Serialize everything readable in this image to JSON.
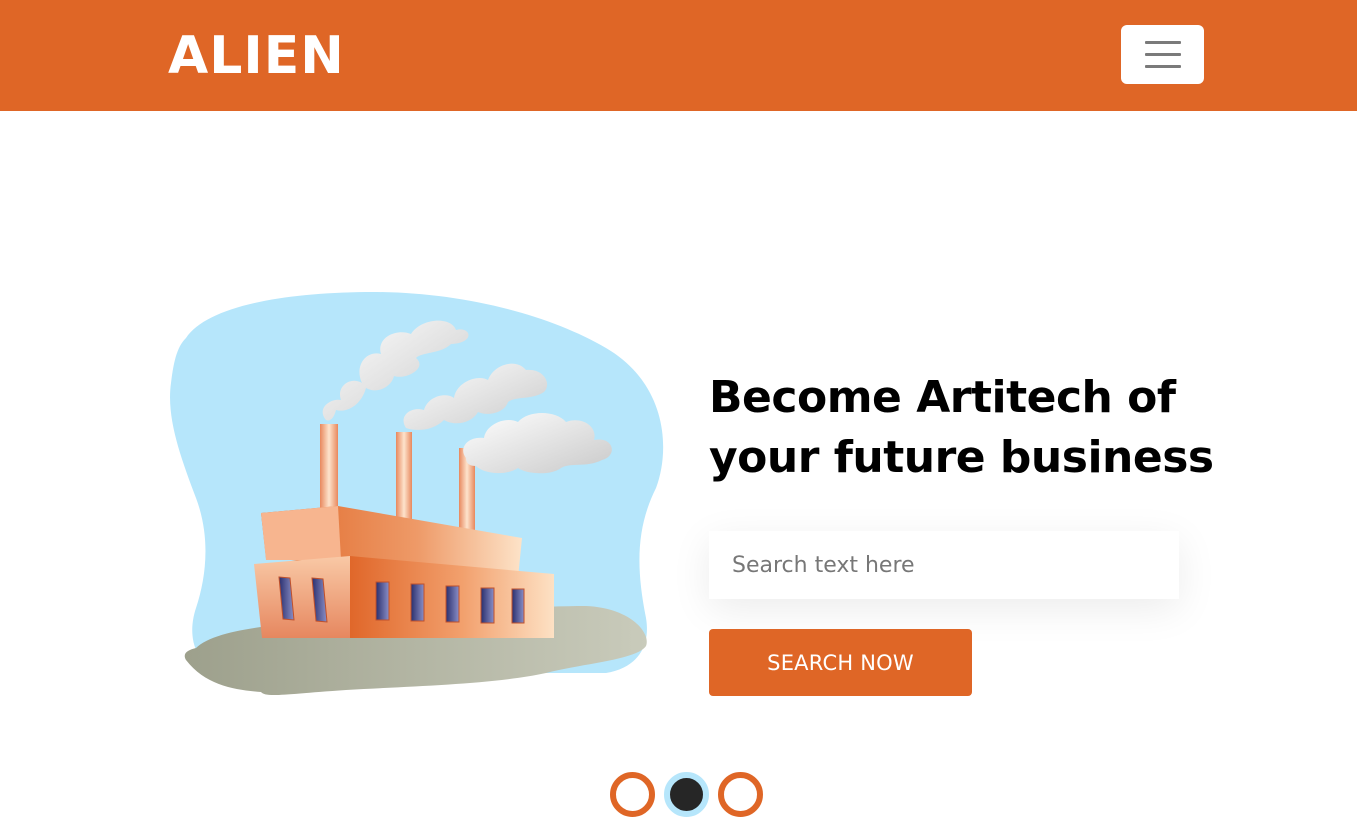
{
  "header": {
    "logo_text": "ALIEN",
    "menu_icon": "hamburger-menu-icon",
    "brand_color": "#df6626"
  },
  "hero": {
    "headline_line1": "Become Artitech of",
    "headline_line2": "your future business",
    "illustration": "factory-illustration",
    "search": {
      "placeholder": "Search text here",
      "value": ""
    },
    "search_button_label": "SEARCH NOW"
  },
  "carousel": {
    "slide_count": 3,
    "active_index": 1,
    "indicator_color": "#df6626",
    "active_color": "#262626"
  }
}
